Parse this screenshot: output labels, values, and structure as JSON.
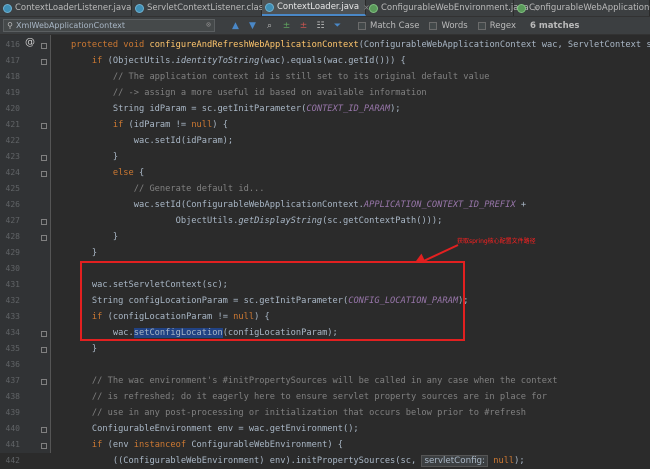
{
  "tabs": [
    {
      "label": "ContextLoaderListener.java",
      "active": false
    },
    {
      "label": "ServletContextListener.class",
      "active": false
    },
    {
      "label": "ContextLoader.java",
      "active": true
    },
    {
      "label": "ConfigurableWebEnvironment.java",
      "active": false
    },
    {
      "label": "ConfigurableWebApplicationCon",
      "active": false
    }
  ],
  "search": {
    "value": "XmlWebApplicationContext",
    "options": [
      "Match Case",
      "Words",
      "Regex"
    ],
    "matches": "6 matches"
  },
  "gutter": {
    "line_numbers": [
      "416",
      "417",
      "418",
      "419",
      "420",
      "421",
      "422",
      "423",
      "424",
      "425",
      "426",
      "427",
      "428",
      "429",
      "430",
      "431",
      "432",
      "433",
      "434",
      "435",
      "436",
      "437",
      "438",
      "439",
      "440",
      "441",
      "442"
    ]
  },
  "code": {
    "l416": {
      "a": "protected void ",
      "b": "configureAndRefreshWebApplicationContext",
      "c": "(ConfigurableWebApplicationContext wac, ServletContext sc) {"
    },
    "l417": {
      "a": "    if ",
      "b": "(ObjectUtils.",
      "c": "identityToString",
      "d": "(wac).equals(wac.getId())) {"
    },
    "l418": "        // The application context id is still set to its original default value",
    "l419": "        // -> assign a more useful id based on available information",
    "l420": {
      "a": "        String idParam = sc.getInitParameter(",
      "b": "CONTEXT_ID_PARAM",
      "c": ");"
    },
    "l421": {
      "a": "        if ",
      "b": "(idParam != ",
      "c": "null",
      "d": ") {"
    },
    "l422": "            wac.setId(idParam);",
    "l423": "        }",
    "l424": {
      "a": "        else ",
      "b": "{"
    },
    "l425": "            // Generate default id...",
    "l426": {
      "a": "            wac.setId(ConfigurableWebApplicationContext.",
      "b": "APPLICATION_CONTEXT_ID_PREFIX",
      "c": " +"
    },
    "l427": {
      "a": "                    ObjectUtils.",
      "b": "getDisplayString",
      "c": "(sc.getContextPath()));"
    },
    "l428": "        }",
    "l429": "    }",
    "l430": "",
    "l431": "    wac.setServletContext(sc);",
    "l432": {
      "a": "    String configLocationParam = sc.getInitParameter(",
      "b": "CONFIG_LOCATION_PARAM",
      "c": ");"
    },
    "l433": {
      "a": "    if ",
      "b": "(configLocationParam != ",
      "c": "null",
      "d": ") {"
    },
    "l434": {
      "a": "        wac.",
      "b": "setConfigLocation",
      "c": "(configLocationParam);"
    },
    "l435": "    }",
    "l436": "",
    "l437": "    // The wac environment's #initPropertySources will be called in any case when the context",
    "l438": "    // is refreshed; do it eagerly here to ensure servlet property sources are in place for",
    "l439": "    // use in any post-processing or initialization that occurs below prior to #refresh",
    "l440": "    ConfigurableEnvironment env = wac.getEnvironment();",
    "l441": {
      "a": "    if ",
      "b": "(env ",
      "c": "instanceof ",
      "d": "ConfigurableWebEnvironment) {"
    },
    "l442": {
      "a": "        ((ConfigurableWebEnvironment) env).initPropertySources(sc, ",
      "b": "servletConfig:",
      "c": " null",
      "d": ");"
    }
  },
  "annotation": "获取spring核心配置文件路径",
  "colors": {
    "keyword": "#cc7832",
    "method": "#ffc66d",
    "comment": "#808080",
    "constant": "#9876aa",
    "annotation": "#e22020"
  }
}
